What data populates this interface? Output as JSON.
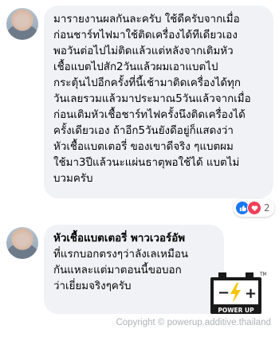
{
  "comments": [
    {
      "author": "",
      "lines": [
        "มารายงานผลกันละครับ ใช้ดีครับจากเมื่อ",
        "ก่อนชาร์ทไฟมาใช้ติดเครื่องได้ทีเดียวเอง",
        "พอวันต่อไปไม่ติดแล้วแต่หลังจากเติมหัว",
        "เชื้อแบตไปสัก2วันแล้วผมเอาแบตไป",
        "กระตุ้นไปอีกครั้งที่นี้เช้ามาติดเครื่องได้ทุก",
        "วันเลยรวมแล้วมาประมาณ5วันแล้วจากเมื่อ",
        "ก่อนเติมหัวเชื้อชาร์ทไฟครั้งนึงติดเครื่องได้",
        "ครั้งเดียวเอง ถ้าอีก5วันยังดีอยู่ก็แสดงว่า",
        "หัวเชื้อแบตเตอรี่ ของเขาดีจริง ๆแบตผม",
        "ใช้มา3ปีแล้วนะแผ่นธาตุพอใช้ได้ แบตไม่",
        "บวมครับ"
      ],
      "reaction_count": "2"
    },
    {
      "author": "หัวเชื้อแบตเตอรี่ พาวเวอร์อัพ",
      "lines": [
        "ที่แรกบอกตรงๆว่าลังเลเหมือน",
        "กันแหละแต่มาตอนนี้ขอบอก",
        "ว่าเยี่ยมจริงๆครับ"
      ]
    }
  ],
  "logo": {
    "text": "POWER UP",
    "trademark": "TM"
  },
  "watermark": "Copyright © powerup.additive.thailand",
  "colors": {
    "bubble": "#f0f2f5",
    "like": "#1877f2",
    "love": "#f33e58",
    "logo_bg": "#1a1a1a",
    "logo_accent": "#f5c400"
  }
}
